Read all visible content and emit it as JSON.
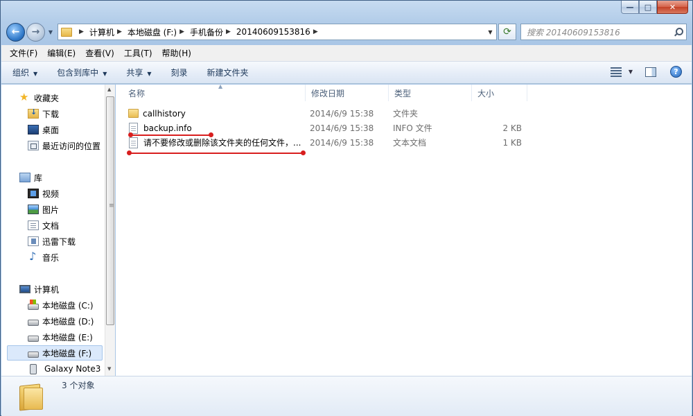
{
  "window": {
    "min_label": "—",
    "max_label": "□",
    "close_label": "✕"
  },
  "address": {
    "back_glyph": "←",
    "forward_glyph": "→",
    "crumbs": [
      "计算机",
      "本地磁盘 (F:)",
      "手机备份",
      "20140609153816"
    ],
    "crumb_sep": "▶",
    "dropdown_glyph": "▼",
    "refresh_glyph": "⟳"
  },
  "search": {
    "placeholder": "搜索 20140609153816"
  },
  "menubar": {
    "items": [
      "文件(F)",
      "编辑(E)",
      "查看(V)",
      "工具(T)",
      "帮助(H)"
    ]
  },
  "commandbar": {
    "organize": "组织",
    "include_library": "包含到库中",
    "share": "共享",
    "burn": "刻录",
    "new_folder": "新建文件夹",
    "arrow": "▼",
    "help_glyph": "?"
  },
  "nav": {
    "favorites": {
      "label": "收藏夹",
      "items": [
        "下载",
        "桌面",
        "最近访问的位置"
      ]
    },
    "libraries": {
      "label": "库",
      "items": [
        "视频",
        "图片",
        "文档",
        "迅雷下载",
        "音乐"
      ]
    },
    "computer": {
      "label": "计算机",
      "items": [
        "本地磁盘 (C:)",
        "本地磁盘 (D:)",
        "本地磁盘 (E:)",
        "本地磁盘 (F:)",
        "Galaxy Note3"
      ],
      "selected": "本地磁盘 (F:)"
    }
  },
  "filelist": {
    "headers": {
      "name": "名称",
      "date": "修改日期",
      "type": "类型",
      "size": "大小"
    },
    "rows": [
      {
        "name": "callhistory",
        "date": "2014/6/9 15:38",
        "type": "文件夹",
        "size": "",
        "icon": "folder-icon"
      },
      {
        "name": "backup.info",
        "date": "2014/6/9 15:38",
        "type": "INFO 文件",
        "size": "2 KB",
        "icon": "file-icon"
      },
      {
        "name": "请不要修改或删除该文件夹的任何文件，...",
        "date": "2014/6/9 15:38",
        "type": "文本文档",
        "size": "1 KB",
        "icon": "text-file-icon"
      }
    ]
  },
  "details": {
    "count": "3 个对象"
  },
  "annotation_color": "#d81e1e"
}
